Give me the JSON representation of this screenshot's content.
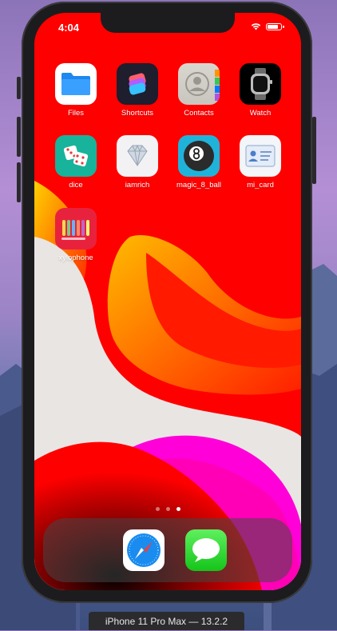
{
  "status_bar": {
    "time": "4:04",
    "battery_level": 0.85
  },
  "home_apps": [
    {
      "label": "Files",
      "icon": "files-folder-icon"
    },
    {
      "label": "Shortcuts",
      "icon": "shortcuts-layers-icon"
    },
    {
      "label": "Contacts",
      "icon": "contacts-person-icon"
    },
    {
      "label": "Watch",
      "icon": "watch-icon"
    },
    {
      "label": "dice",
      "icon": "dice-icon"
    },
    {
      "label": "iamrich",
      "icon": "diamond-icon"
    },
    {
      "label": "magic_8_ball",
      "icon": "eight-ball-icon"
    },
    {
      "label": "mi_card",
      "icon": "id-card-icon"
    },
    {
      "label": "xylophone",
      "icon": "xylophone-icon"
    }
  ],
  "page_indicator": {
    "count": 3,
    "active": 2
  },
  "dock_apps": [
    {
      "name": "Safari",
      "icon": "safari-compass-icon"
    },
    {
      "name": "Messages",
      "icon": "messages-bubble-icon"
    }
  ],
  "simulator_label": "iPhone 11 Pro Max — 13.2.2"
}
